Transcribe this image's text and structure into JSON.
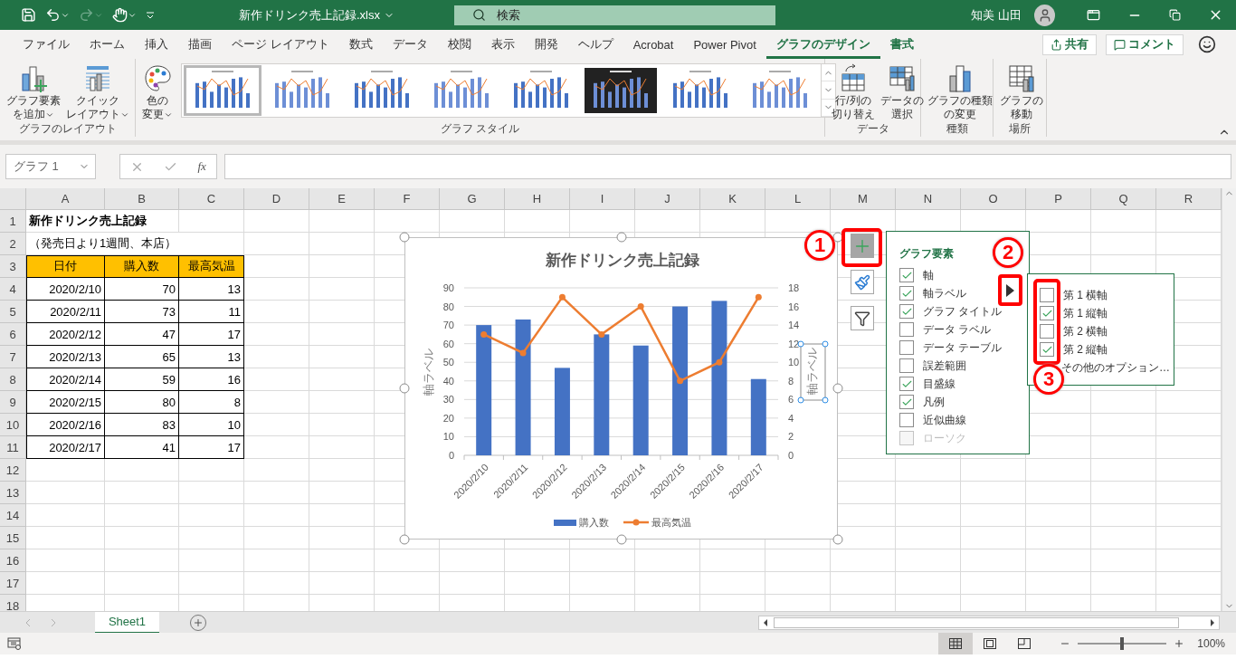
{
  "title_bar": {
    "file_name": "新作ドリンク売上記録.xlsx",
    "search_placeholder": "検索",
    "user_name": "知美 山田"
  },
  "menu_tabs": [
    {
      "label": "ファイル",
      "selected": false,
      "kind": "normal"
    },
    {
      "label": "ホーム",
      "selected": false,
      "kind": "normal"
    },
    {
      "label": "挿入",
      "selected": false,
      "kind": "normal"
    },
    {
      "label": "描画",
      "selected": false,
      "kind": "normal"
    },
    {
      "label": "ページ レイアウト",
      "selected": false,
      "kind": "normal"
    },
    {
      "label": "数式",
      "selected": false,
      "kind": "normal"
    },
    {
      "label": "データ",
      "selected": false,
      "kind": "normal"
    },
    {
      "label": "校閲",
      "selected": false,
      "kind": "normal"
    },
    {
      "label": "表示",
      "selected": false,
      "kind": "normal"
    },
    {
      "label": "開発",
      "selected": false,
      "kind": "normal"
    },
    {
      "label": "ヘルプ",
      "selected": false,
      "kind": "normal"
    },
    {
      "label": "Acrobat",
      "selected": false,
      "kind": "normal"
    },
    {
      "label": "Power Pivot",
      "selected": false,
      "kind": "normal"
    },
    {
      "label": "グラフのデザイン",
      "selected": true,
      "kind": "contextual"
    },
    {
      "label": "書式",
      "selected": false,
      "kind": "contextual"
    }
  ],
  "share_button": "共有",
  "comment_button": "コメント",
  "ribbon": {
    "groups": [
      {
        "label": "グラフのレイアウト",
        "items": [
          {
            "kind": "add-element",
            "lines": [
              "グラフ要素",
              "を追加"
            ],
            "dropdown": true
          },
          {
            "kind": "quick-layout",
            "lines": [
              "クイック",
              "レイアウト"
            ],
            "dropdown": true
          }
        ]
      },
      {
        "label": "グラフ スタイル",
        "items": [
          {
            "kind": "colors",
            "lines": [
              "色の",
              "変更"
            ],
            "dropdown": true
          }
        ],
        "gallery": [
          {
            "selected": true,
            "dark": false
          },
          {
            "selected": false,
            "dark": false
          },
          {
            "selected": false,
            "dark": false
          },
          {
            "selected": false,
            "dark": false
          },
          {
            "selected": false,
            "dark": false
          },
          {
            "selected": false,
            "dark": true
          },
          {
            "selected": false,
            "dark": false
          },
          {
            "selected": false,
            "dark": false
          }
        ]
      },
      {
        "label": "データ",
        "items": [
          {
            "kind": "switch-row-column",
            "lines": [
              "行/列の",
              "切り替え"
            ],
            "dropdown": false
          },
          {
            "kind": "select-data",
            "lines": [
              "データの",
              "選択"
            ],
            "dropdown": false
          }
        ]
      },
      {
        "label": "種類",
        "items": [
          {
            "kind": "change-type",
            "lines": [
              "グラフの種類",
              "の変更"
            ],
            "dropdown": false
          }
        ]
      },
      {
        "label": "場所",
        "items": [
          {
            "kind": "move-chart",
            "lines": [
              "グラフの",
              "移動"
            ],
            "dropdown": false
          }
        ]
      }
    ]
  },
  "formula_bar": {
    "name_box": "グラフ 1",
    "fx": "fx"
  },
  "sheet": {
    "columns": [
      "A",
      "B",
      "C",
      "D",
      "E",
      "F",
      "G",
      "H",
      "I",
      "J",
      "K",
      "L",
      "M",
      "N",
      "O",
      "P",
      "Q",
      "R"
    ],
    "row_numbers": [
      "1",
      "2",
      "3",
      "4",
      "5",
      "6",
      "7",
      "8",
      "9",
      "10",
      "11",
      "12",
      "13",
      "14",
      "15",
      "16",
      "17",
      "18"
    ],
    "rows": [
      {
        "kind": "title",
        "text": "新作ドリンク売上記録"
      },
      {
        "kind": "subtitle",
        "text": "（発売日より1週間、本店）"
      },
      {
        "kind": "header",
        "cells": [
          "日付",
          "購入数",
          "最高気温"
        ]
      },
      {
        "kind": "data",
        "cells": [
          "2020/2/10",
          "70",
          "13"
        ]
      },
      {
        "kind": "data",
        "cells": [
          "2020/2/11",
          "73",
          "11"
        ]
      },
      {
        "kind": "data",
        "cells": [
          "2020/2/12",
          "47",
          "17"
        ]
      },
      {
        "kind": "data",
        "cells": [
          "2020/2/13",
          "65",
          "13"
        ]
      },
      {
        "kind": "data",
        "cells": [
          "2020/2/14",
          "59",
          "16"
        ]
      },
      {
        "kind": "data",
        "cells": [
          "2020/2/15",
          "80",
          "8"
        ]
      },
      {
        "kind": "data",
        "cells": [
          "2020/2/16",
          "83",
          "10"
        ]
      },
      {
        "kind": "data",
        "cells": [
          "2020/2/17",
          "41",
          "17"
        ]
      }
    ]
  },
  "chart": {
    "secondary_axis_label_selected": true,
    "side_buttons": [
      {
        "kind": "elements",
        "selected": true
      },
      {
        "kind": "styles",
        "selected": false
      },
      {
        "kind": "filter",
        "selected": false
      }
    ],
    "chart_data": {
      "type": "bar",
      "title": "新作ドリンク売上記録",
      "categories": [
        "2020/2/10",
        "2020/2/11",
        "2020/2/12",
        "2020/2/13",
        "2020/2/14",
        "2020/2/15",
        "2020/2/16",
        "2020/2/17"
      ],
      "series": [
        {
          "name": "購入数",
          "color": "#4472c4",
          "values": [
            70,
            73,
            47,
            65,
            59,
            80,
            83,
            41
          ]
        },
        {
          "name": "最高気温",
          "color": "#ed7d31",
          "type": "line",
          "axis": "y2",
          "marker": "circle",
          "values": [
            13,
            11,
            17,
            13,
            16,
            8,
            10,
            17
          ]
        }
      ],
      "grid": true,
      "legend": "bottom",
      "ylabel": "軸ラベル",
      "y2label": "軸ラベル",
      "ylim": [
        0,
        90
      ],
      "yticks": [
        0,
        10,
        20,
        30,
        40,
        50,
        60,
        70,
        80,
        90
      ],
      "y2lim": [
        0,
        18
      ],
      "y2ticks": [
        0,
        2,
        4,
        6,
        8,
        10,
        12,
        14,
        16,
        18
      ]
    }
  },
  "chart_elements_panel": {
    "title": "グラフ要素",
    "items": [
      {
        "label": "軸",
        "checked": true,
        "disabled": false
      },
      {
        "label": "軸ラベル",
        "checked": true,
        "disabled": false
      },
      {
        "label": "グラフ タイトル",
        "checked": true,
        "disabled": false
      },
      {
        "label": "データ ラベル",
        "checked": false,
        "disabled": false
      },
      {
        "label": "データ テーブル",
        "checked": false,
        "disabled": false
      },
      {
        "label": "誤差範囲",
        "checked": false,
        "disabled": false
      },
      {
        "label": "目盛線",
        "checked": true,
        "disabled": false
      },
      {
        "label": "凡例",
        "checked": true,
        "disabled": false
      },
      {
        "label": "近似曲線",
        "checked": false,
        "disabled": false
      },
      {
        "label": "ローソク",
        "checked": false,
        "disabled": true
      }
    ]
  },
  "axes_submenu": {
    "items": [
      {
        "label": "第 1 横軸",
        "checked": false
      },
      {
        "label": "第 1 縦軸",
        "checked": true
      },
      {
        "label": "第 2 横軸",
        "checked": false
      },
      {
        "label": "第 2 縦軸",
        "checked": true
      }
    ],
    "more_options": "その他のオプション…"
  },
  "callouts": [
    "1",
    "2",
    "3"
  ],
  "sheet_tabs": [
    {
      "label": "Sheet1",
      "selected": true
    }
  ],
  "status_bar": {
    "views": [
      {
        "kind": "normal",
        "selected": true
      },
      {
        "kind": "page-layout",
        "selected": false
      },
      {
        "kind": "page-break",
        "selected": false
      }
    ],
    "zoom": {
      "level": 0.5,
      "reading": "100%"
    }
  }
}
